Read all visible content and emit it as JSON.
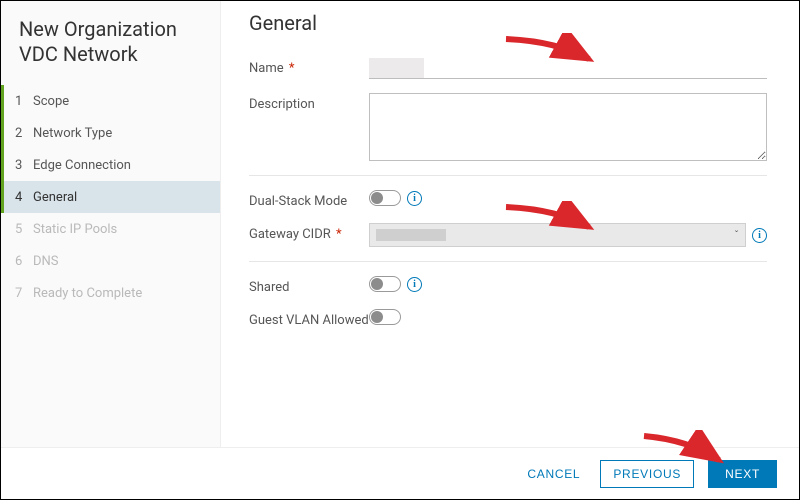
{
  "wizard_title": "New Organization VDC Network",
  "steps": [
    {
      "num": "1",
      "label": "Scope",
      "state": "completed"
    },
    {
      "num": "2",
      "label": "Network Type",
      "state": "completed"
    },
    {
      "num": "3",
      "label": "Edge Connection",
      "state": "completed"
    },
    {
      "num": "4",
      "label": "General",
      "state": "current"
    },
    {
      "num": "5",
      "label": "Static IP Pools",
      "state": "future"
    },
    {
      "num": "6",
      "label": "DNS",
      "state": "future"
    },
    {
      "num": "7",
      "label": "Ready to Complete",
      "state": "future"
    }
  ],
  "general": {
    "heading": "General",
    "labels": {
      "name": "Name",
      "description": "Description",
      "dual_stack": "Dual-Stack Mode",
      "gateway_cidr": "Gateway CIDR",
      "shared": "Shared",
      "guest_vlan": "Guest VLAN Allowed"
    },
    "required_mark": "*",
    "values": {
      "name": "",
      "description": "",
      "dual_stack_on": false,
      "gateway_cidr": "",
      "shared_on": false,
      "guest_vlan_on": false
    }
  },
  "footer": {
    "cancel": "CANCEL",
    "previous": "PREVIOUS",
    "next": "NEXT"
  },
  "info_glyph": "i"
}
